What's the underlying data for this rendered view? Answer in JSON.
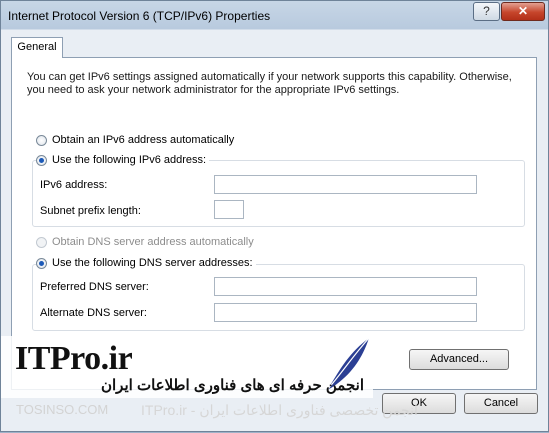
{
  "window": {
    "title": "Internet Protocol Version 6 (TCP/IPv6) Properties",
    "help_glyph": "?",
    "close_glyph": "✕"
  },
  "tabs": [
    {
      "label": "General"
    }
  ],
  "intro_text": "You can get IPv6 settings assigned automatically if your network supports this capability. Otherwise, you need to ask your network administrator for the appropriate IPv6 settings.",
  "ip": {
    "auto_label": "Obtain an IPv6 address automatically",
    "manual_label": "Use the following IPv6 address:",
    "selected": "manual",
    "fields": [
      {
        "label": "IPv6 address:",
        "value": ""
      },
      {
        "label": "Subnet prefix length:",
        "value": ""
      }
    ]
  },
  "dns": {
    "auto_label": "Obtain DNS server address automatically",
    "manual_label": "Use the following DNS server addresses:",
    "selected": "manual",
    "fields": [
      {
        "label": "Preferred DNS server:",
        "value": ""
      },
      {
        "label": "Alternate DNS server:",
        "value": ""
      }
    ]
  },
  "buttons": {
    "advanced": "Advanced...",
    "ok": "OK",
    "cancel": "Cancel"
  },
  "watermark": {
    "logo": "ITPro.ir",
    "tagline_fa": "انجمن حرفه ای های فناوری اطلاعات ایران",
    "site": "TOSINSO.COM",
    "bottom_fa": "انجمن تخصصی فناوری اطلاعات ایران - ITPro.ir"
  }
}
